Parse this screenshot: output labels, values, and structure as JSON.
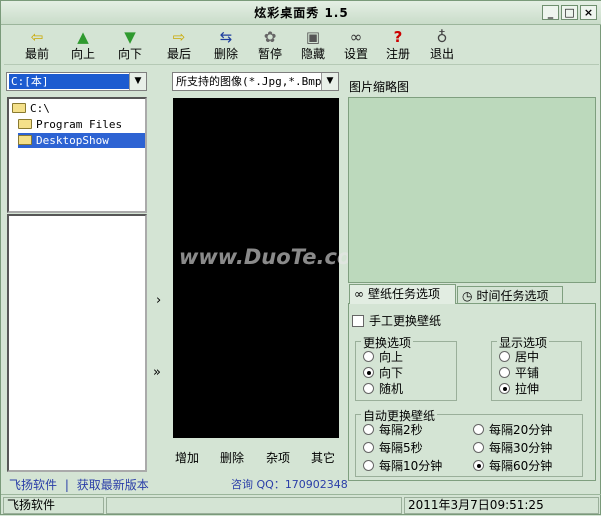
{
  "window": {
    "title": "炫彩桌面秀 1.5",
    "min": "_",
    "max": "□",
    "close": "×"
  },
  "toolbar": [
    {
      "label": "最前",
      "icon": "⇦"
    },
    {
      "label": "向上",
      "icon": "▲"
    },
    {
      "label": "向下",
      "icon": "▼"
    },
    {
      "label": "最后",
      "icon": "⇨"
    },
    {
      "label": "删除",
      "icon": "⇆"
    },
    {
      "label": "暂停",
      "icon": "✿"
    },
    {
      "label": "隐藏",
      "icon": "▣"
    },
    {
      "label": "设置",
      "icon": "∞"
    },
    {
      "label": "注册",
      "icon": "?"
    },
    {
      "label": "退出",
      "icon": "♁"
    }
  ],
  "drive_select": "C:[本]",
  "filter_select": "所支持的图像(*.Jpg,*.Bmp",
  "tree": [
    "C:\\",
    "Program Files",
    "DesktopShow"
  ],
  "arrow_single": "›",
  "arrow_double": "»",
  "preview_actions": [
    "增加",
    "删除",
    "杂项",
    "其它"
  ],
  "left_links": {
    "vendor": "飞扬软件",
    "separator": "|",
    "update": "获取最新版本"
  },
  "consult": "咨询 QQ：170902348",
  "thumbnail_label": "图片缩略图",
  "tabs": [
    "壁纸任务选项",
    "时间任务选项"
  ],
  "manual_change": "手工更换壁纸",
  "change_options": {
    "label": "更换选项",
    "items": [
      "向上",
      "向下",
      "随机"
    ],
    "selected": 1
  },
  "display_options": {
    "label": "显示选项",
    "items": [
      "居中",
      "平铺",
      "拉伸"
    ],
    "selected": 2
  },
  "auto_change": {
    "label": "自动更换壁纸",
    "items": [
      "每隔2秒",
      "每隔20分钟",
      "每隔5秒",
      "每隔30分钟",
      "每隔10分钟",
      "每隔60分钟"
    ],
    "selected": 5
  },
  "status": {
    "left": "飞扬软件",
    "middle": "",
    "datetime": "2011年3月7日09:51:25"
  },
  "watermark": "www.DuoTe.com"
}
